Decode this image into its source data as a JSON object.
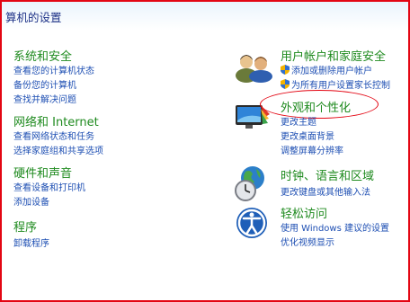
{
  "header": {
    "title": "算机的设置"
  },
  "left": [
    {
      "title": "系统和安全",
      "links": [
        "查看您的计算机状态",
        "备份您的计算机",
        "查找并解决问题"
      ]
    },
    {
      "title": "网络和 Internet",
      "links": [
        "查看网络状态和任务",
        "选择家庭组和共享选项"
      ]
    },
    {
      "title": "硬件和声音",
      "links": [
        "查看设备和打印机",
        "添加设备"
      ]
    },
    {
      "title": "程序",
      "links": [
        "卸载程序"
      ]
    }
  ],
  "right": [
    {
      "title": "用户帐户和家庭安全",
      "icon": "users-icon",
      "links": [
        "添加或删除用户帐户",
        "为所有用户设置家长控制"
      ]
    },
    {
      "title": "外观和个性化",
      "icon": "appearance-icon",
      "links": [
        "更改主题",
        "更改桌面背景",
        "调整屏幕分辨率"
      ]
    },
    {
      "title": "时钟、语言和区域",
      "icon": "clock-globe-icon",
      "links": [
        "更改键盘或其他输入法"
      ]
    },
    {
      "title": "轻松访问",
      "icon": "accessibility-icon",
      "links": [
        "使用 Windows 建议的设置",
        "优化视频显示"
      ]
    }
  ],
  "colors": {
    "category": "#1e8a1e",
    "link": "#1e4fb3",
    "highlight": "#e30613"
  }
}
